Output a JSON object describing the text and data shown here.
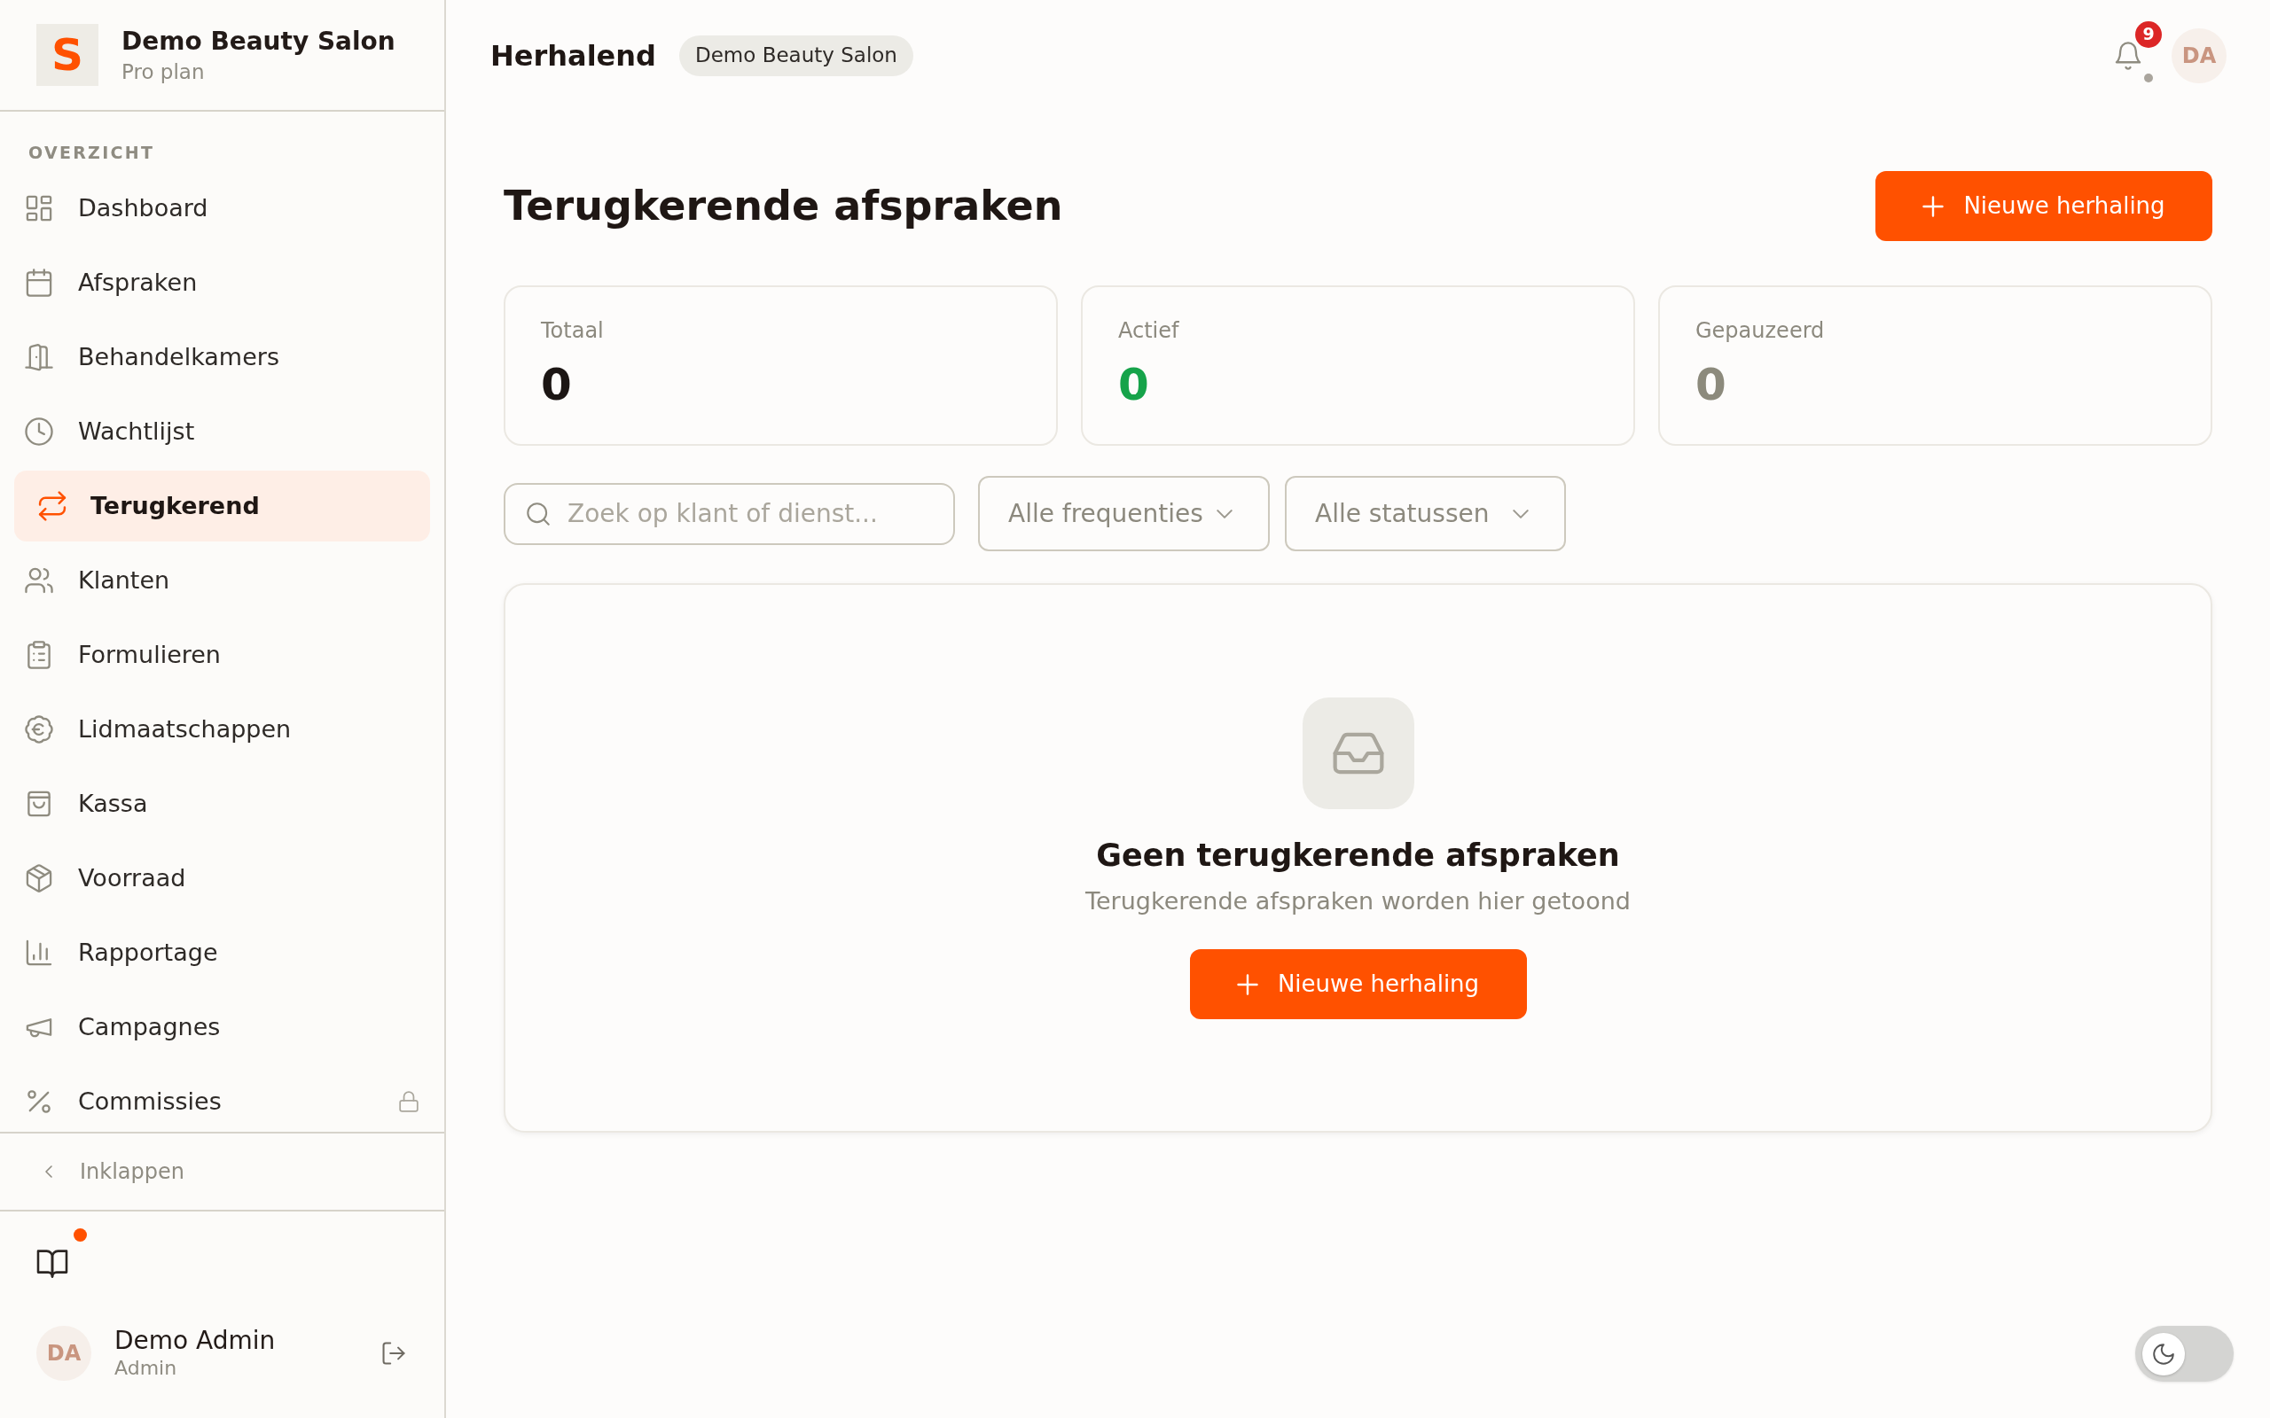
{
  "sidebar": {
    "brand": {
      "logo": "S",
      "name": "Demo Beauty Salon",
      "plan": "Pro plan"
    },
    "section_label": "OVERZICHT",
    "items": [
      {
        "label": "Dashboard",
        "selected": false,
        "locked": false
      },
      {
        "label": "Afspraken",
        "selected": false,
        "locked": false
      },
      {
        "label": "Behandelkamers",
        "selected": false,
        "locked": false
      },
      {
        "label": "Wachtlijst",
        "selected": false,
        "locked": false
      },
      {
        "label": "Terugkerend",
        "selected": true,
        "locked": false
      },
      {
        "label": "Klanten",
        "selected": false,
        "locked": false
      },
      {
        "label": "Formulieren",
        "selected": false,
        "locked": false
      },
      {
        "label": "Lidmaatschappen",
        "selected": false,
        "locked": false
      },
      {
        "label": "Kassa",
        "selected": false,
        "locked": false
      },
      {
        "label": "Voorraad",
        "selected": false,
        "locked": false
      },
      {
        "label": "Rapportage",
        "selected": false,
        "locked": false
      },
      {
        "label": "Campagnes",
        "selected": false,
        "locked": false
      },
      {
        "label": "Commissies",
        "selected": false,
        "locked": true
      }
    ],
    "collapse": {
      "label": "Inklappen"
    },
    "docs": {
      "unread": true
    },
    "user": {
      "initials": "DA",
      "name": "Demo Admin",
      "role": "Admin"
    }
  },
  "header": {
    "title": "Herhalend",
    "salon": "Demo Beauty Salon",
    "notifications": {
      "count": "9"
    },
    "avatar": "DA"
  },
  "page": {
    "title": "Terugkerende afspraken",
    "new_button": "Nieuwe herhaling",
    "stats": [
      {
        "label": "Totaal",
        "value": "0",
        "color": "#1c1614"
      },
      {
        "label": "Actief",
        "value": "0",
        "color": "#16a34a"
      },
      {
        "label": "Gepauzeerd",
        "value": "0",
        "color": "#8c8a7c"
      }
    ],
    "search": {
      "placeholder": "Zoek op klant of dienst..."
    },
    "filters": [
      {
        "value": "Alle frequenties"
      },
      {
        "value": "Alle statussen"
      }
    ],
    "empty_state": {
      "title": "Geen terugkerende afspraken",
      "text": "Terugkerende afspraken worden hier getoond",
      "button": "Nieuwe herhaling"
    }
  },
  "theme_toggle": {
    "on": false
  }
}
